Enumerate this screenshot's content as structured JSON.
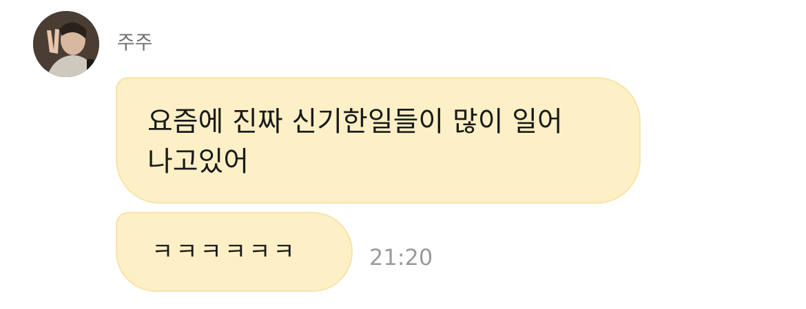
{
  "chat": {
    "sender": {
      "name": "주주",
      "avatar_icon": "profile-photo"
    },
    "messages": [
      {
        "text": "요즘에 진짜 신기한일들이 많이 일어\n나고있어"
      },
      {
        "text": "ㅋㅋㅋㅋㅋㅋ",
        "time": "21:20"
      }
    ],
    "colors": {
      "bubble": "#fdf0c6",
      "timestamp": "#9a9a9a",
      "name": "#6f6f6f"
    }
  }
}
